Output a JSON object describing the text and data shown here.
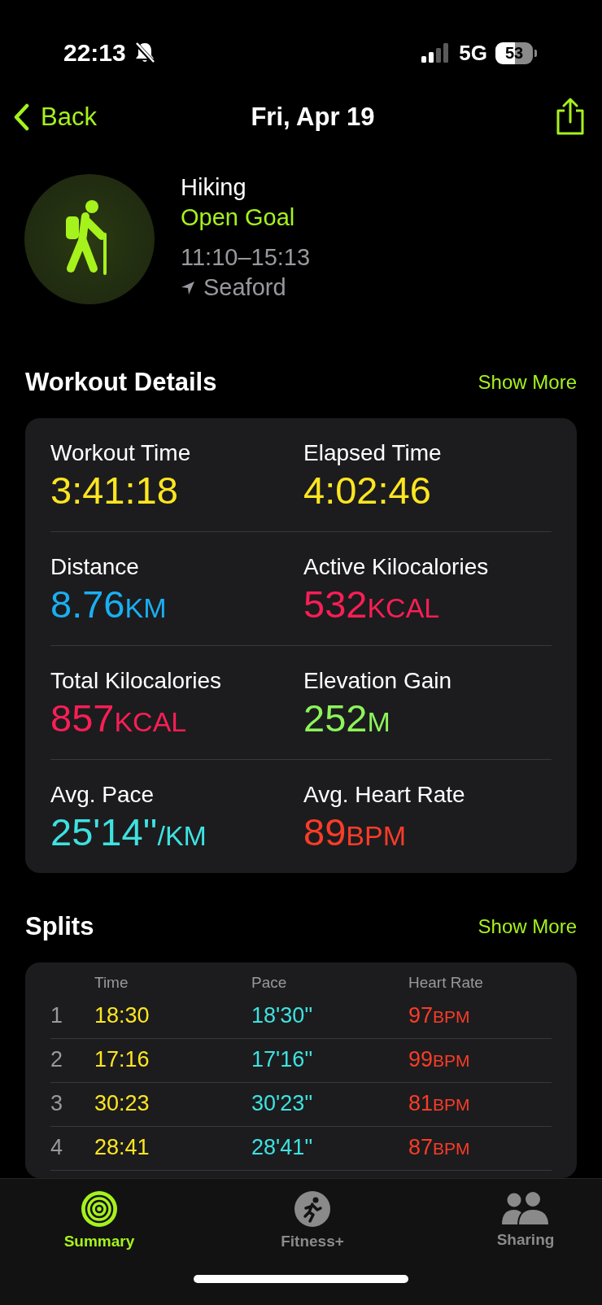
{
  "status_bar": {
    "time": "22:13",
    "network": "5G",
    "battery": "53"
  },
  "nav": {
    "back": "Back",
    "title": "Fri, Apr 19"
  },
  "workout": {
    "type": "Hiking",
    "goal": "Open Goal",
    "time_range": "11:10–15:13",
    "location": "Seaford"
  },
  "details": {
    "title": "Workout Details",
    "show_more": "Show More",
    "metrics": [
      {
        "label": "Workout Time",
        "value": "3:41:18",
        "color": "#ffe620"
      },
      {
        "label": "Elapsed Time",
        "value": "4:02:46",
        "color": "#ffe620"
      },
      {
        "label": "Distance",
        "value": "8.76",
        "unit": "KM",
        "color": "#1aaff2"
      },
      {
        "label": "Active Kilocalories",
        "value": "532",
        "unit": "KCAL",
        "color": "#fa1e55"
      },
      {
        "label": "Total Kilocalories",
        "value": "857",
        "unit": "KCAL",
        "color": "#fa1e55"
      },
      {
        "label": "Elevation Gain",
        "value": "252",
        "unit": "M",
        "color": "#8cf55a"
      },
      {
        "label": "Avg. Pace",
        "value": "25'14''",
        "unit": "/KM",
        "color": "#3ee2e0"
      },
      {
        "label": "Avg. Heart Rate",
        "value": "89",
        "unit": "BPM",
        "color": "#fa3c28"
      }
    ]
  },
  "splits": {
    "title": "Splits",
    "show_more": "Show More",
    "columns": [
      "Time",
      "Pace",
      "Heart Rate"
    ],
    "rows": [
      {
        "index": "1",
        "time": "18:30",
        "pace": "18'30''",
        "heart_rate": "97",
        "unit": "BPM"
      },
      {
        "index": "2",
        "time": "17:16",
        "pace": "17'16''",
        "heart_rate": "99",
        "unit": "BPM"
      },
      {
        "index": "3",
        "time": "30:23",
        "pace": "30'23''",
        "heart_rate": "81",
        "unit": "BPM"
      },
      {
        "index": "4",
        "time": "28:41",
        "pace": "28'41''",
        "heart_rate": "87",
        "unit": "BPM"
      }
    ]
  },
  "tabs": [
    {
      "label": "Summary",
      "selected": true,
      "kind": "rings"
    },
    {
      "label": "Fitness+",
      "selected": false,
      "kind": "runner"
    },
    {
      "label": "Sharing",
      "selected": false,
      "kind": "people"
    }
  ]
}
